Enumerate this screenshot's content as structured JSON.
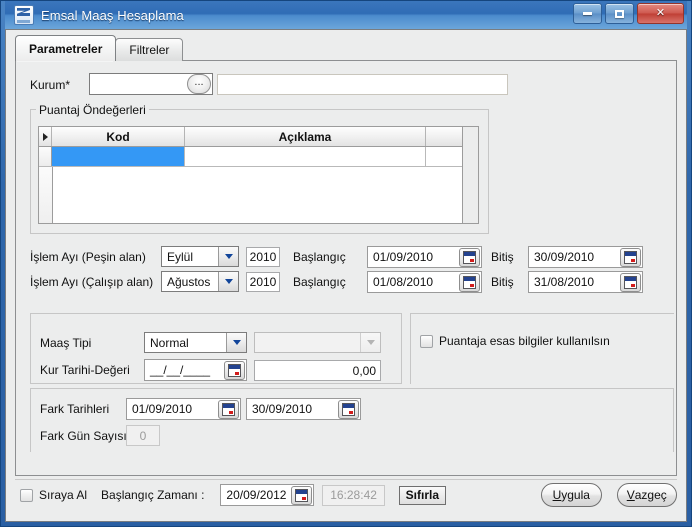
{
  "window": {
    "title": "Emsal Maaş Hesaplama",
    "icon": "app-icon",
    "buttons": {
      "minimize": "minimize-icon",
      "maximize": "maximize-icon",
      "close": "✕"
    }
  },
  "tabs": [
    {
      "label": "Parametreler",
      "active": true
    },
    {
      "label": "Filtreler",
      "active": false
    }
  ],
  "form": {
    "kurum": {
      "label": "Kurum*",
      "code_value": "",
      "browse_label": "...",
      "name_value": ""
    },
    "puantaj": {
      "group_title": "Puantaj Öndeğerleri",
      "columns": [
        "Kod",
        "Açıklama"
      ],
      "rows": [
        {
          "kod": "",
          "aciklama": "",
          "selected": true
        }
      ]
    },
    "islem_ayi_pesin": {
      "label": "İşlem Ayı (Peşin alan)",
      "month": "Eylül",
      "year": "2010",
      "start_label": "Başlangıç",
      "start_date": "01/09/2010",
      "end_label": "Bitiş",
      "end_date": "30/09/2010"
    },
    "islem_ayi_calisip": {
      "label": "İşlem Ayı (Çalışıp alan)",
      "month": "Ağustos",
      "year": "2010",
      "start_label": "Başlangıç",
      "start_date": "01/08/2010",
      "end_label": "Bitiş",
      "end_date": "31/08/2010"
    },
    "maas": {
      "tipi_label": "Maaş Tipi",
      "tipi_value": "Normal",
      "tipi_secondary_value": "",
      "kur_label": "Kur Tarihi-Değeri",
      "kur_date": "__/__/____",
      "kur_value": "0,00",
      "puantaj_checkbox_label": "Puantaja esas bilgiler kullanılsın",
      "puantaj_checkbox_checked": false
    },
    "fark": {
      "tarihleri_label": "Fark Tarihleri",
      "tarih_start": "01/09/2010",
      "tarih_end": "30/09/2010",
      "gun_sayisi_label": "Fark Gün Sayısı",
      "gun_sayisi_value": "0"
    }
  },
  "footer": {
    "siraya_al_label": "Sıraya Al",
    "siraya_al_checked": false,
    "baslangic_zamani_label": "Başlangıç Zamanı :",
    "baslangic_tarihi": "20/09/2012",
    "baslangic_saati": "16:28:42",
    "sifirla_label": "Sıfırla",
    "uygula_label": "Uygula",
    "uygula_accel": "U",
    "uygula_rest": "ygula",
    "vazgec_label": "Vazgeç",
    "vazgec_accel": "V",
    "vazgec_rest": "azgeç"
  },
  "colors": {
    "title_blue": "#2f6cb5",
    "selection_blue": "#3498f5",
    "panel_gray": "#eceded",
    "close_red": "#bf3f35"
  }
}
